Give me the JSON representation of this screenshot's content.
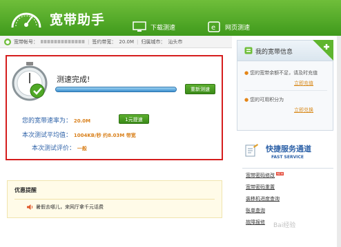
{
  "header": {
    "app_title": "宽带助手",
    "tabs": [
      {
        "label": "下载测速"
      },
      {
        "label": "网页测速"
      }
    ]
  },
  "info_bar": {
    "account_label": "宽带帐号：",
    "speed_label": "签约带宽：",
    "speed_value": "20.0M",
    "city_label": "归属城市：",
    "city_value": "汕头市"
  },
  "test": {
    "status": "测速完成!",
    "progress": 1.0,
    "retest_label": "重新测速",
    "rate_label": "您的宽带速率为：",
    "rate_value": "20.0M",
    "upgrade_label": "1元提速",
    "avg_label": "本次测试平均值：",
    "avg_value": "1004KB/秒 约8.03M 带宽",
    "eval_label": "本次测试评价：",
    "eval_value": "一般"
  },
  "promo": {
    "title": "优惠提醒",
    "item": "暑假去哪儿，来网厅拿千元话费"
  },
  "my_info": {
    "title": "我的宽带信息",
    "line1": "您的宽带余额不足，请及时充值",
    "link1": "立即充值",
    "line2": "您的可用积分为",
    "link2": "立即兑换"
  },
  "service": {
    "title": "快捷服务通道",
    "subtitle": "FAST SERVICE",
    "new_badge": "NEW",
    "items": [
      "宽带密码修改",
      "宽带密码重置",
      "装移机进度查询",
      "账单查询",
      "故障报修"
    ]
  },
  "watermark": "Bai经验",
  "colors": {
    "header_green": "#4fa826",
    "highlight_red": "#d51c1c",
    "link_blue": "#2e62a8",
    "value_orange": "#d9801b"
  }
}
